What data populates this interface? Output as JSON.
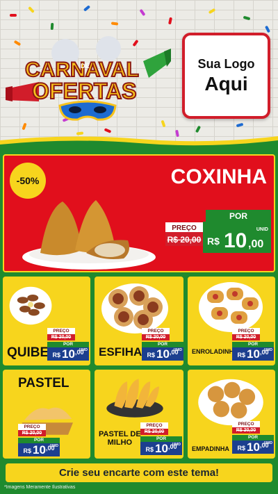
{
  "header": {
    "carnival_logo": {
      "line1": "CARNAVAL",
      "small_word": "DE",
      "line2": "OFERTAS"
    },
    "logo_box": {
      "line1": "Sua Logo",
      "line2": "Aqui"
    }
  },
  "featured": {
    "discount_badge": "-50%",
    "name": "COXINHA",
    "price": {
      "preco_label": "PREÇO",
      "old_price": "R$ 20,00",
      "old_price_old_value": "20",
      "old_price_decimals": ",00",
      "por_label": "POR",
      "currency": "R$",
      "new_int": "10",
      "new_dec": ",00",
      "unit": "UNID"
    }
  },
  "products": [
    {
      "name": "QUIBE",
      "preco_label": "PREÇO",
      "old_price": "R$ 20,00",
      "por_label": "POR",
      "currency": "R$",
      "new_int": "10",
      "new_dec": ",00",
      "unit": "UNID"
    },
    {
      "name": "ESFIHA",
      "preco_label": "PREÇO",
      "old_price": "R$ 20,00",
      "por_label": "POR",
      "currency": "R$",
      "new_int": "10",
      "new_dec": ",00",
      "unit": "UNID"
    },
    {
      "name": "ENROLADINHO",
      "preco_label": "PREÇO",
      "old_price": "R$ 20,00",
      "por_label": "POR",
      "currency": "R$",
      "new_int": "10",
      "new_dec": ",00",
      "unit": "UNID"
    },
    {
      "name": "PASTEL",
      "preco_label": "PREÇO",
      "old_price": "R$ 20,00",
      "por_label": "POR",
      "currency": "R$",
      "new_int": "10",
      "new_dec": ",00",
      "unit": "UNID"
    },
    {
      "name_line1": "PASTEL DE",
      "name_line2": "MILHO",
      "preco_label": "PREÇO",
      "old_price": "R$ 20,00",
      "por_label": "POR",
      "currency": "R$",
      "new_int": "10",
      "new_dec": ",00",
      "unit": "UNID"
    },
    {
      "name": "EMPADINHA",
      "preco_label": "PREÇO",
      "old_price": "R$ 20,00",
      "por_label": "POR",
      "currency": "R$",
      "new_int": "10",
      "new_dec": ",00",
      "unit": "UNID"
    }
  ],
  "footer": {
    "banner": "Crie seu encarte com este tema!",
    "disclaimer": "*Imagens Meramente Ilustrativas"
  },
  "colors": {
    "red": "#e10f1c",
    "yellow": "#f7d51d",
    "green": "#1f8a2e",
    "blue": "#1c3f8f"
  },
  "icons": [
    "confetti-decoration",
    "carnival-mask-icon",
    "party-horn-icon"
  ]
}
